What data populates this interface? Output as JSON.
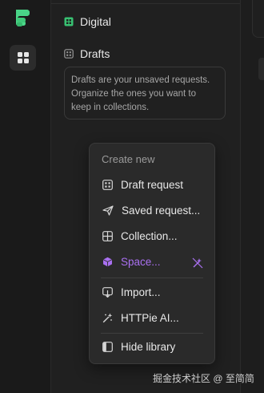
{
  "sidebar": {
    "items": [
      {
        "label": "Digital",
        "icon": "grid-icon",
        "color": "#38c172"
      },
      {
        "label": "Drafts",
        "icon": "grid-icon",
        "color": "#9a9a9a"
      }
    ],
    "drafts_note": "Drafts are your unsaved requests. Organize the ones you want to keep in collections."
  },
  "menu": {
    "title": "Create new",
    "items": [
      {
        "label": "Draft request",
        "icon": "draft-grid-icon"
      },
      {
        "label": "Saved request...",
        "icon": "send-icon"
      },
      {
        "label": "Collection...",
        "icon": "collection-icon"
      },
      {
        "label": "Space...",
        "icon": "cube-icon",
        "color": "#a970f0"
      },
      {
        "label": "Import...",
        "icon": "import-icon"
      },
      {
        "label": "HTTPie AI...",
        "icon": "magic-wand-icon"
      },
      {
        "label": "Hide library",
        "icon": "sidebar-icon"
      }
    ]
  },
  "watermark": "掘金技术社区 @ 至简简",
  "colors": {
    "accent_green": "#38c172",
    "accent_purple": "#a970f0"
  }
}
